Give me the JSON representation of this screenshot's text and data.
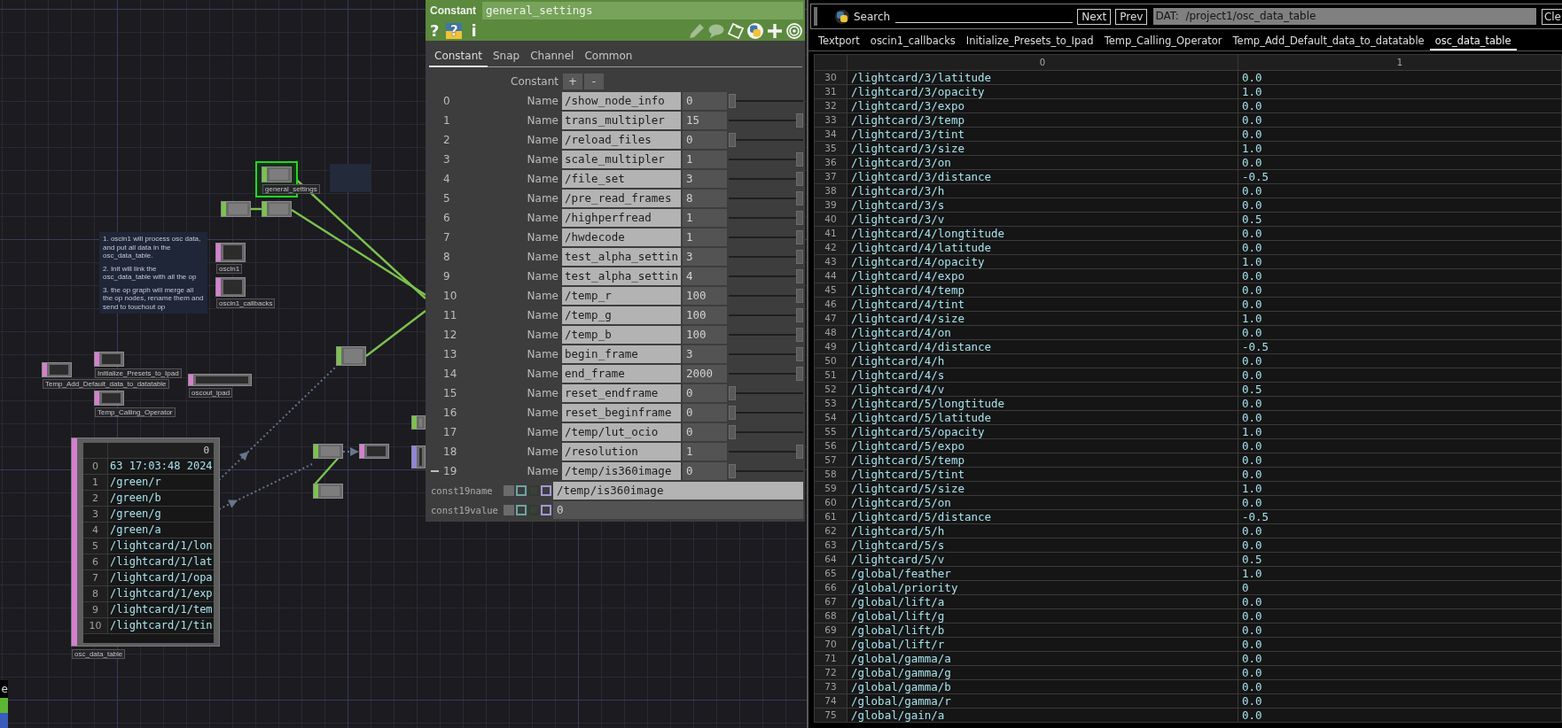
{
  "network": {
    "nodes": [
      {
        "kind": "chop",
        "label": "general_settings",
        "selected": true
      },
      {
        "kind": "chop",
        "selected": false
      },
      {
        "kind": "chop",
        "selected": false
      },
      {
        "kind": "dat",
        "label": "oscin1",
        "selected": false
      },
      {
        "kind": "dat",
        "label": "oscin1_callbacks",
        "selected": false
      },
      {
        "kind": "chop",
        "selected": false
      },
      {
        "kind": "dat",
        "label": "Initialize_Presets_to_Ipad",
        "selected": false
      },
      {
        "kind": "dat",
        "label": "Temp_Add_Default_data_to_datatable",
        "selected": false
      },
      {
        "kind": "dat",
        "label": "oscout_ipad",
        "selected": false
      },
      {
        "kind": "dat",
        "label": "Temp_Calling_Operator",
        "selected": false
      },
      {
        "kind": "chop",
        "selected": false
      },
      {
        "kind": "chop",
        "selected": false
      },
      {
        "kind": "dat",
        "selected": false
      },
      {
        "kind": "comp",
        "selected": false
      },
      {
        "kind": "chop",
        "selected": false
      }
    ],
    "wires": [
      {
        "kind": "chop"
      },
      {
        "kind": "chop"
      },
      {
        "kind": "chop"
      },
      {
        "kind": "chop"
      },
      {
        "kind": "chop"
      },
      {
        "kind": "reference"
      },
      {
        "kind": "reference"
      },
      {
        "kind": "reference"
      }
    ],
    "comments": [
      {
        "paragraphs": [
          "1. oscin1 will process osc data, and put all data in the osc_data_table.",
          "2. Init will link the osc_data_table with all the op",
          "3. the op graph will merge all the op nodes, rename them and send to touchout op"
        ]
      }
    ],
    "table_viewer": {
      "label": "osc_data_table",
      "header": "0",
      "rows": [
        {
          "index": "0",
          "value": "63 17:03:48 2024"
        },
        {
          "index": "1",
          "value": "/green/r"
        },
        {
          "index": "2",
          "value": "/green/b"
        },
        {
          "index": "3",
          "value": "/green/g"
        },
        {
          "index": "4",
          "value": "/green/a"
        },
        {
          "index": "5",
          "value": "/lightcard/1/lon"
        },
        {
          "index": "6",
          "value": "/lightcard/1/lat"
        },
        {
          "index": "7",
          "value": "/lightcard/1/opa"
        },
        {
          "index": "8",
          "value": "/lightcard/1/exp"
        },
        {
          "index": "9",
          "value": "/lightcard/1/tem"
        },
        {
          "index": "10",
          "value": "/lightcard/1/tin"
        }
      ]
    },
    "corner": {
      "text": "e",
      "swatches": [
        {
          "color": "#5db633"
        },
        {
          "color": "#3a5cbd"
        }
      ]
    }
  },
  "parameters": {
    "op_type": "Constant",
    "op_name": "general_settings",
    "tools": [
      {
        "kind": "help",
        "glyph": "?"
      },
      {
        "kind": "python_help",
        "glyph": "?"
      },
      {
        "kind": "info",
        "glyph": "i"
      }
    ],
    "header_icons": [
      {
        "kind": "edit",
        "enabled": false
      },
      {
        "kind": "comment",
        "enabled": false
      },
      {
        "kind": "note",
        "enabled": true
      },
      {
        "kind": "python",
        "enabled": true
      },
      {
        "kind": "add",
        "enabled": true
      },
      {
        "kind": "target",
        "enabled": true
      }
    ],
    "tabs": [
      {
        "label": "Constant",
        "selected": true
      },
      {
        "label": "Snap",
        "selected": false
      },
      {
        "label": "Channel",
        "selected": false
      },
      {
        "label": "Common",
        "selected": false
      }
    ],
    "group_label": "Constant",
    "add_button": "+",
    "remove_button": "-",
    "rows": [
      {
        "index": "0",
        "label": "Name",
        "name": "/show_node_info",
        "value": "0",
        "level": 0,
        "marked": false
      },
      {
        "index": "1",
        "label": "Name",
        "name": "trans_multipler",
        "value": "15",
        "level": 1,
        "marked": false
      },
      {
        "index": "2",
        "label": "Name",
        "name": "/reload_files",
        "value": "0",
        "level": 0,
        "marked": false
      },
      {
        "index": "3",
        "label": "Name",
        "name": "scale_multipler",
        "value": "1",
        "level": 1,
        "marked": false
      },
      {
        "index": "4",
        "label": "Name",
        "name": "/file_set",
        "value": "3",
        "level": 1,
        "marked": false
      },
      {
        "index": "5",
        "label": "Name",
        "name": "/pre_read_frames",
        "value": "8",
        "level": 1,
        "marked": false
      },
      {
        "index": "6",
        "label": "Name",
        "name": "/highperfread",
        "value": "1",
        "level": 1,
        "marked": false
      },
      {
        "index": "7",
        "label": "Name",
        "name": "/hwdecode",
        "value": "1",
        "level": 1,
        "marked": false
      },
      {
        "index": "8",
        "label": "Name",
        "name": "test_alpha_settin",
        "value": "3",
        "level": 1,
        "marked": false
      },
      {
        "index": "9",
        "label": "Name",
        "name": "test_alpha_settin",
        "value": "4",
        "level": 1,
        "marked": false
      },
      {
        "index": "10",
        "label": "Name",
        "name": "/temp_r",
        "value": "100",
        "level": 1,
        "marked": false
      },
      {
        "index": "11",
        "label": "Name",
        "name": "/temp_g",
        "value": "100",
        "level": 1,
        "marked": false
      },
      {
        "index": "12",
        "label": "Name",
        "name": "/temp_b",
        "value": "100",
        "level": 1,
        "marked": false
      },
      {
        "index": "13",
        "label": "Name",
        "name": "begin_frame",
        "value": "3",
        "level": 1,
        "marked": false
      },
      {
        "index": "14",
        "label": "Name",
        "name": "end_frame",
        "value": "2000",
        "level": 1,
        "marked": false
      },
      {
        "index": "15",
        "label": "Name",
        "name": "reset_endframe",
        "value": "0",
        "level": 0,
        "marked": false
      },
      {
        "index": "16",
        "label": "Name",
        "name": "reset_beginframe",
        "value": "0",
        "level": 0,
        "marked": false
      },
      {
        "index": "17",
        "label": "Name",
        "name": "/temp/lut_ocio",
        "value": "0",
        "level": 0,
        "marked": false
      },
      {
        "index": "18",
        "label": "Name",
        "name": "/resolution",
        "value": "1",
        "level": 1,
        "marked": false
      },
      {
        "index": "19",
        "label": "Name",
        "name": "/temp/is360image",
        "value": "0",
        "level": 0,
        "marked": true
      }
    ],
    "fields": [
      {
        "label": "const19name",
        "kind": "text",
        "value": "/temp/is360image",
        "modes": [
          {
            "color": "#6b6b6b",
            "selected": true
          },
          {
            "color": "#6fa3a3",
            "selected": false
          },
          {
            "color": "#2f3d2b",
            "selected": false
          },
          {
            "color": "#a596d6",
            "selected": false
          }
        ]
      },
      {
        "label": "const19value",
        "kind": "number",
        "value": "0",
        "modes": [
          {
            "color": "#6b6b6b",
            "selected": true
          },
          {
            "color": "#6fa3a3",
            "selected": false
          },
          {
            "color": "#2f3d2b",
            "selected": false
          },
          {
            "color": "#a596d6",
            "selected": false
          }
        ]
      }
    ]
  },
  "textport": {
    "search_label": "Search",
    "next": "Next",
    "prev": "Prev",
    "path": "DAT:  /project1/osc_data_table",
    "clear": "Cle",
    "tabs": [
      {
        "label": "Textport",
        "selected": false
      },
      {
        "label": "oscin1_callbacks",
        "selected": false
      },
      {
        "label": "Initialize_Presets_to_Ipad",
        "selected": false
      },
      {
        "label": "Temp_Calling_Operator",
        "selected": false
      },
      {
        "label": "Temp_Add_Default_data_to_datatable",
        "selected": false
      },
      {
        "label": "osc_data_table",
        "selected": true
      }
    ],
    "table": {
      "columns": [
        "0",
        "1"
      ],
      "rows": [
        {
          "index": "30",
          "cells": [
            "/lightcard/3/latitude",
            "0.0"
          ]
        },
        {
          "index": "31",
          "cells": [
            "/lightcard/3/opacity",
            "1.0"
          ]
        },
        {
          "index": "32",
          "cells": [
            "/lightcard/3/expo",
            "0.0"
          ]
        },
        {
          "index": "33",
          "cells": [
            "/lightcard/3/temp",
            "0.0"
          ]
        },
        {
          "index": "34",
          "cells": [
            "/lightcard/3/tint",
            "0.0"
          ]
        },
        {
          "index": "35",
          "cells": [
            "/lightcard/3/size",
            "1.0"
          ]
        },
        {
          "index": "36",
          "cells": [
            "/lightcard/3/on",
            "0.0"
          ]
        },
        {
          "index": "37",
          "cells": [
            "/lightcard/3/distance",
            "-0.5"
          ]
        },
        {
          "index": "38",
          "cells": [
            "/lightcard/3/h",
            "0.0"
          ]
        },
        {
          "index": "39",
          "cells": [
            "/lightcard/3/s",
            "0.0"
          ]
        },
        {
          "index": "40",
          "cells": [
            "/lightcard/3/v",
            "0.5"
          ]
        },
        {
          "index": "41",
          "cells": [
            "/lightcard/4/longtitude",
            "0.0"
          ]
        },
        {
          "index": "42",
          "cells": [
            "/lightcard/4/latitude",
            "0.0"
          ]
        },
        {
          "index": "43",
          "cells": [
            "/lightcard/4/opacity",
            "1.0"
          ]
        },
        {
          "index": "44",
          "cells": [
            "/lightcard/4/expo",
            "0.0"
          ]
        },
        {
          "index": "45",
          "cells": [
            "/lightcard/4/temp",
            "0.0"
          ]
        },
        {
          "index": "46",
          "cells": [
            "/lightcard/4/tint",
            "0.0"
          ]
        },
        {
          "index": "47",
          "cells": [
            "/lightcard/4/size",
            "1.0"
          ]
        },
        {
          "index": "48",
          "cells": [
            "/lightcard/4/on",
            "0.0"
          ]
        },
        {
          "index": "49",
          "cells": [
            "/lightcard/4/distance",
            "-0.5"
          ]
        },
        {
          "index": "50",
          "cells": [
            "/lightcard/4/h",
            "0.0"
          ]
        },
        {
          "index": "51",
          "cells": [
            "/lightcard/4/s",
            "0.0"
          ]
        },
        {
          "index": "52",
          "cells": [
            "/lightcard/4/v",
            "0.5"
          ]
        },
        {
          "index": "53",
          "cells": [
            "/lightcard/5/longtitude",
            "0.0"
          ]
        },
        {
          "index": "54",
          "cells": [
            "/lightcard/5/latitude",
            "0.0"
          ]
        },
        {
          "index": "55",
          "cells": [
            "/lightcard/5/opacity",
            "1.0"
          ]
        },
        {
          "index": "56",
          "cells": [
            "/lightcard/5/expo",
            "0.0"
          ]
        },
        {
          "index": "57",
          "cells": [
            "/lightcard/5/temp",
            "0.0"
          ]
        },
        {
          "index": "58",
          "cells": [
            "/lightcard/5/tint",
            "0.0"
          ]
        },
        {
          "index": "59",
          "cells": [
            "/lightcard/5/size",
            "1.0"
          ]
        },
        {
          "index": "60",
          "cells": [
            "/lightcard/5/on",
            "0.0"
          ]
        },
        {
          "index": "61",
          "cells": [
            "/lightcard/5/distance",
            "-0.5"
          ]
        },
        {
          "index": "62",
          "cells": [
            "/lightcard/5/h",
            "0.0"
          ]
        },
        {
          "index": "63",
          "cells": [
            "/lightcard/5/s",
            "0.0"
          ]
        },
        {
          "index": "64",
          "cells": [
            "/lightcard/5/v",
            "0.5"
          ]
        },
        {
          "index": "65",
          "cells": [
            "/global/feather",
            "1.0"
          ]
        },
        {
          "index": "66",
          "cells": [
            "/global/priority",
            "0"
          ]
        },
        {
          "index": "67",
          "cells": [
            "/global/lift/a",
            "0.0"
          ]
        },
        {
          "index": "68",
          "cells": [
            "/global/lift/g",
            "0.0"
          ]
        },
        {
          "index": "69",
          "cells": [
            "/global/lift/b",
            "0.0"
          ]
        },
        {
          "index": "70",
          "cells": [
            "/global/lift/r",
            "0.0"
          ]
        },
        {
          "index": "71",
          "cells": [
            "/global/gamma/a",
            "0.0"
          ]
        },
        {
          "index": "72",
          "cells": [
            "/global/gamma/g",
            "0.0"
          ]
        },
        {
          "index": "73",
          "cells": [
            "/global/gamma/b",
            "0.0"
          ]
        },
        {
          "index": "74",
          "cells": [
            "/global/gamma/r",
            "0.0"
          ]
        },
        {
          "index": "75",
          "cells": [
            "/global/gain/a",
            "0.0"
          ]
        }
      ]
    }
  }
}
